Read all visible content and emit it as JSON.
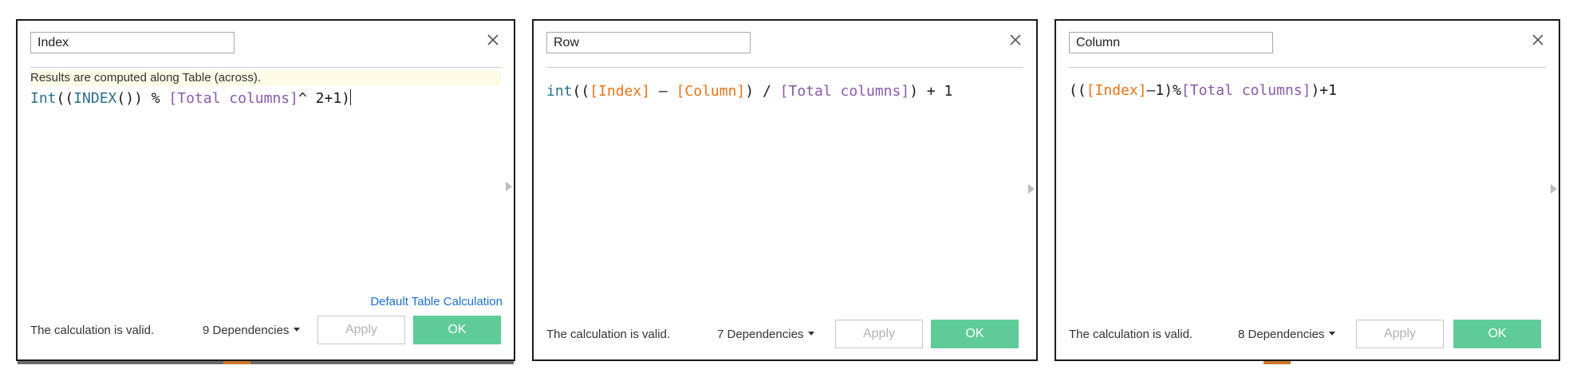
{
  "colors": {
    "ok_button": "#5fcb98",
    "link": "#1f6fd1",
    "function": "#2a6f8f",
    "field_orange": "#e8741a",
    "field_purple": "#8a5aa8",
    "info_bar": "#fdfbe6"
  },
  "icons": {
    "close": "close-icon",
    "expand": "right-arrow-icon",
    "dropdown": "chevron-down-icon"
  },
  "dialogs": [
    {
      "name": "Index",
      "info": "Results are computed along Table (across).",
      "formula": {
        "p1": "Int",
        "p2": "((",
        "p3": "INDEX",
        "p4": "()) % ",
        "p5": "[Total columns]",
        "p6": "^ 2+1)"
      },
      "link": "Default Table Calculation",
      "status": "The calculation is valid.",
      "dependencies": "9 Dependencies",
      "apply": "Apply",
      "ok": "OK"
    },
    {
      "name": "Row",
      "formula": {
        "p1": "int",
        "p2": "((",
        "p3": "[Index]",
        "p4": " – ",
        "p5": "[Column]",
        "p6": ") / ",
        "p7": "[Total columns]",
        "p8": ") + 1"
      },
      "status": "The calculation is valid.",
      "dependencies": "7 Dependencies",
      "apply": "Apply",
      "ok": "OK"
    },
    {
      "name": "Column",
      "formula": {
        "p1": "((",
        "p2": "[Index]",
        "p3": "–1)%",
        "p4": "[Total columns]",
        "p5": ")+1"
      },
      "status": "The calculation is valid.",
      "dependencies": "8 Dependencies",
      "apply": "Apply",
      "ok": "OK"
    }
  ]
}
